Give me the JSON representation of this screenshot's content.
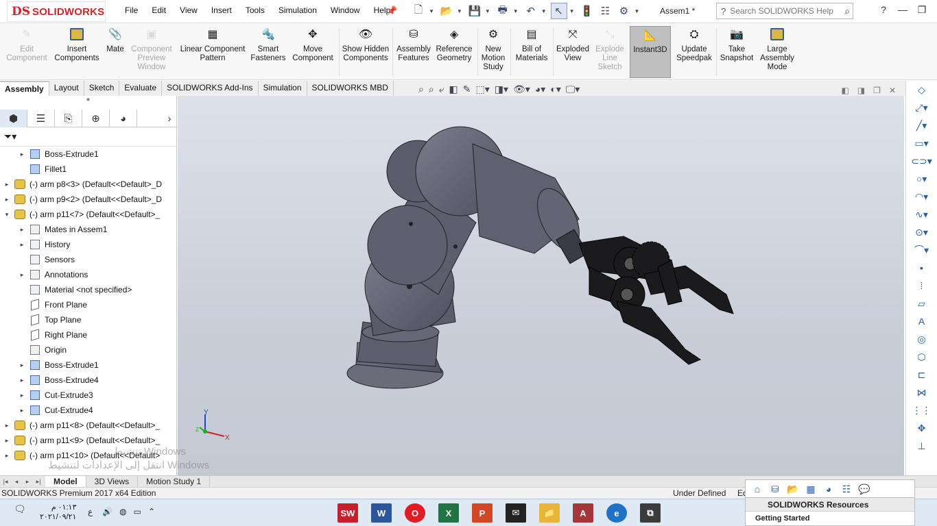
{
  "app": {
    "logo_mark": "DS",
    "logo_text": "SOLIDWORKS",
    "document_title": "Assem1 *"
  },
  "menu": [
    "File",
    "Edit",
    "View",
    "Insert",
    "Tools",
    "Simulation",
    "Window",
    "Help"
  ],
  "search": {
    "placeholder": "Search SOLIDWORKS Help"
  },
  "ribbon": [
    {
      "label": "Edit Component",
      "enabled": false
    },
    {
      "label": "Insert Components",
      "enabled": true
    },
    {
      "label": "Mate",
      "enabled": true
    },
    {
      "label": "Component Preview Window",
      "enabled": false
    },
    {
      "label": "Linear Component Pattern",
      "enabled": true
    },
    {
      "label": "Smart Fasteners",
      "enabled": true
    },
    {
      "label": "Move Component",
      "enabled": true
    },
    {
      "label": "Show Hidden Components",
      "enabled": true
    },
    {
      "label": "Assembly Features",
      "enabled": true
    },
    {
      "label": "Reference Geometry",
      "enabled": true
    },
    {
      "label": "New Motion Study",
      "enabled": true
    },
    {
      "label": "Bill of Materials",
      "enabled": true
    },
    {
      "label": "Exploded View",
      "enabled": true
    },
    {
      "label": "Explode Line Sketch",
      "enabled": false
    },
    {
      "label": "Instant3D",
      "enabled": true,
      "active": true
    },
    {
      "label": "Update Speedpak",
      "enabled": true
    },
    {
      "label": "Take Snapshot",
      "enabled": true
    },
    {
      "label": "Large Assembly Mode",
      "enabled": true
    }
  ],
  "command_tabs": [
    "Assembly",
    "Layout",
    "Sketch",
    "Evaluate",
    "SOLIDWORKS Add-Ins",
    "Simulation",
    "SOLIDWORKS MBD"
  ],
  "active_command_tab": "Assembly",
  "tree": [
    {
      "label": "Boss-Extrude1",
      "indent": 1,
      "icon": "part-icon",
      "expand": true
    },
    {
      "label": "Fillet1",
      "indent": 1,
      "icon": "part-icon",
      "expand": false
    },
    {
      "label": "(-) arm p8<3> (Default<<Default>_D",
      "indent": 0,
      "icon": "assembly-icon",
      "expand": true
    },
    {
      "label": "(-) arm p9<2> (Default<<Default>_D",
      "indent": 0,
      "icon": "assembly-icon",
      "expand": true
    },
    {
      "label": "(-) arm p11<7> (Default<<Default>_",
      "indent": 0,
      "icon": "assembly-icon",
      "expand": true,
      "open": true
    },
    {
      "label": "Mates in Assem1",
      "indent": 1,
      "icon": "generic-icon",
      "expand": true
    },
    {
      "label": "History",
      "indent": 1,
      "icon": "generic-icon",
      "expand": true
    },
    {
      "label": "Sensors",
      "indent": 1,
      "icon": "generic-icon",
      "expand": false
    },
    {
      "label": "Annotations",
      "indent": 1,
      "icon": "generic-icon",
      "expand": true
    },
    {
      "label": "Material <not specified>",
      "indent": 1,
      "icon": "generic-icon",
      "expand": false
    },
    {
      "label": "Front Plane",
      "indent": 1,
      "icon": "plane-icon",
      "expand": false
    },
    {
      "label": "Top Plane",
      "indent": 1,
      "icon": "plane-icon",
      "expand": false
    },
    {
      "label": "Right Plane",
      "indent": 1,
      "icon": "plane-icon",
      "expand": false
    },
    {
      "label": "Origin",
      "indent": 1,
      "icon": "origin-icon",
      "expand": false
    },
    {
      "label": "Boss-Extrude1",
      "indent": 1,
      "icon": "part-icon",
      "expand": true
    },
    {
      "label": "Boss-Extrude4",
      "indent": 1,
      "icon": "part-icon",
      "expand": true
    },
    {
      "label": "Cut-Extrude3",
      "indent": 1,
      "icon": "part-icon",
      "expand": true
    },
    {
      "label": "Cut-Extrude4",
      "indent": 1,
      "icon": "part-icon",
      "expand": true
    },
    {
      "label": "(-) arm p11<8> (Default<<Default>_",
      "indent": 0,
      "icon": "assembly-icon",
      "expand": true
    },
    {
      "label": "(-) arm p11<9> (Default<<Default>_",
      "indent": 0,
      "icon": "assembly-icon",
      "expand": true
    },
    {
      "label": "(-) arm p11<10> (Default<<Default>",
      "indent": 0,
      "icon": "assembly-icon",
      "expand": true
    }
  ],
  "triad": {
    "x": "X",
    "y": "Y",
    "z": "Z"
  },
  "watermark": {
    "line1": "تنشيط Windows",
    "line2": "انتقل إلى الإعدادات لتنشيط Windows"
  },
  "bottom_tabs": [
    "Model",
    "3D Views",
    "Motion Study 1"
  ],
  "active_bottom_tab": "Model",
  "status": {
    "edition": "SOLIDWORKS Premium 2017 x64 Edition",
    "definition": "Under Defined",
    "truncated": "Ed"
  },
  "resources": {
    "title": "SOLIDWORKS Resources",
    "item": "Getting Started"
  },
  "taskbar": {
    "time": "٠١:١٣ م",
    "date": "٢٠٢١/٠٩/٢١",
    "lang": "ع"
  },
  "colors": {
    "brand": "#d2232a",
    "viewport_top": "#dde1ea",
    "viewport_bottom": "#c4c9d4",
    "arm_body": "#5f6170",
    "gripper": "#1b1b1e"
  }
}
